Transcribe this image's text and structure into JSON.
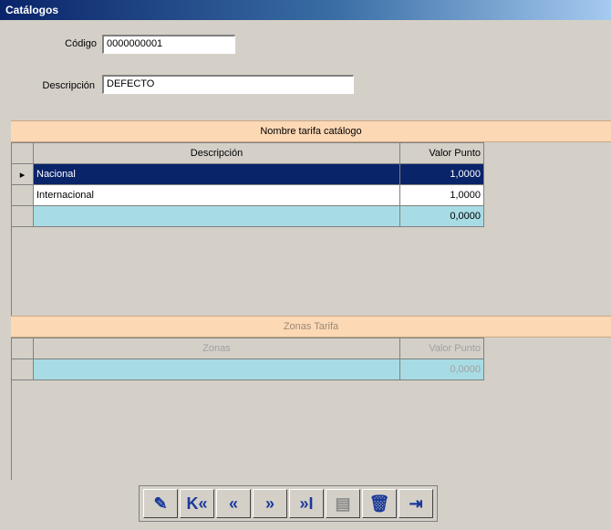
{
  "window": {
    "title": "Catálogos"
  },
  "form": {
    "codigo_label": "Código",
    "codigo_value": "0000000001",
    "descripcion_label": "Descripción",
    "descripcion_value": "DEFECTO"
  },
  "tarifas": {
    "header": "Nombre tarifa catálogo",
    "columns": [
      "Descripción",
      "Valor Punto"
    ],
    "rows": [
      {
        "descripcion": "Nacional",
        "valor": "1,0000"
      },
      {
        "descripcion": "Internacional",
        "valor": "1,0000"
      },
      {
        "descripcion": "",
        "valor": "0,0000"
      }
    ]
  },
  "zonas": {
    "header": "Zonas Tarifa",
    "columns": [
      "Zonas",
      "Valor Punto"
    ],
    "rows": [
      {
        "zona": "",
        "valor": "0,0000"
      }
    ]
  },
  "toolbar": {
    "buttons": [
      {
        "name": "edit-icon",
        "glyph": "✎"
      },
      {
        "name": "first-record-icon",
        "glyph": "K«"
      },
      {
        "name": "previous-record-icon",
        "glyph": "«"
      },
      {
        "name": "next-record-icon",
        "glyph": "»"
      },
      {
        "name": "last-record-icon",
        "glyph": "»I"
      },
      {
        "name": "save-icon",
        "glyph": "▤"
      },
      {
        "name": "delete-icon",
        "glyph": "🗑"
      },
      {
        "name": "exit-icon",
        "glyph": "⇥"
      }
    ]
  }
}
